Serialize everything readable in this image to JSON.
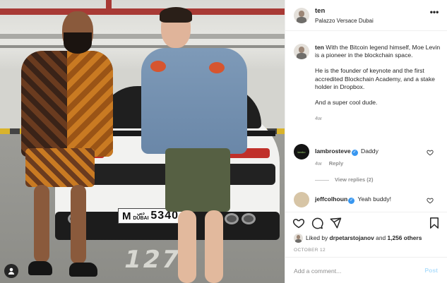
{
  "post": {
    "author": "ten",
    "location": "Palazzo Versace Dubai",
    "more_icon": "more-horizontal-icon",
    "caption_user": "ten",
    "caption_lines": [
      "With the Bitcoin legend himself, Moe Levin is a pioneer in the blockchain space.",
      "He is the founder of keynote and the first accredited Blockchain Academy, and a stake holder in Dropbox.",
      "And a super cool dude."
    ],
    "caption_time": "4w"
  },
  "photo": {
    "floor_number": "127",
    "plate_code": "M",
    "plate_city": "دبي DUBAI",
    "plate_number": "5340",
    "tag_icon": "user-tag-icon"
  },
  "comments": [
    {
      "user": "lambrosteve",
      "verified": true,
      "text": "Daddy",
      "time": "4w",
      "reply_label": "Reply",
      "avatar_color": "#1a1a1a"
    },
    {
      "user": "jeffcolhoun",
      "verified": true,
      "text": "Yeah buddy!",
      "time": "",
      "reply_label": "",
      "avatar_color": "#d7c5a6"
    }
  ],
  "view_replies": "View replies (2)",
  "actions": {
    "like_icon": "heart-icon",
    "comment_icon": "comment-icon",
    "share_icon": "send-icon",
    "save_icon": "bookmark-icon"
  },
  "likes": {
    "prefix": "Liked by",
    "user": "drpetarstojanov",
    "conjunction": "and",
    "others": "1,256 others"
  },
  "date": "OCTOBER 12",
  "add_comment": {
    "placeholder": "Add a comment...",
    "post_label": "Post"
  },
  "colors": {
    "verified": "#3897f0",
    "post_disabled": "#b2dffc",
    "muted_text": "#8e8e8e"
  }
}
